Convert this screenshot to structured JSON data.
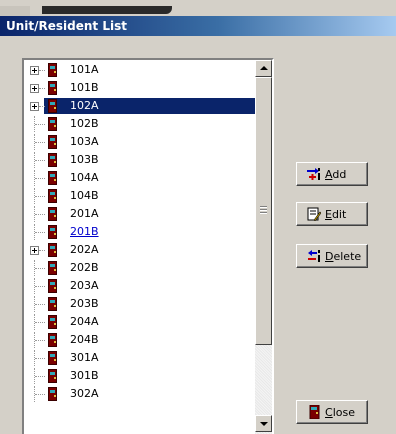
{
  "window": {
    "title": "Unit/Resident List"
  },
  "tree": {
    "items": [
      {
        "label": "101A",
        "expandable": true,
        "selected": false,
        "link": false
      },
      {
        "label": "101B",
        "expandable": true,
        "selected": false,
        "link": false
      },
      {
        "label": "102A",
        "expandable": true,
        "selected": true,
        "link": false
      },
      {
        "label": "102B",
        "expandable": false,
        "selected": false,
        "link": false
      },
      {
        "label": "103A",
        "expandable": false,
        "selected": false,
        "link": false
      },
      {
        "label": "103B",
        "expandable": false,
        "selected": false,
        "link": false
      },
      {
        "label": "104A",
        "expandable": false,
        "selected": false,
        "link": false
      },
      {
        "label": "104B",
        "expandable": false,
        "selected": false,
        "link": false
      },
      {
        "label": "201A",
        "expandable": false,
        "selected": false,
        "link": false
      },
      {
        "label": "201B",
        "expandable": false,
        "selected": false,
        "link": true
      },
      {
        "label": "202A",
        "expandable": true,
        "selected": false,
        "link": false
      },
      {
        "label": "202B",
        "expandable": false,
        "selected": false,
        "link": false
      },
      {
        "label": "203A",
        "expandable": false,
        "selected": false,
        "link": false
      },
      {
        "label": "203B",
        "expandable": false,
        "selected": false,
        "link": false
      },
      {
        "label": "204A",
        "expandable": false,
        "selected": false,
        "link": false
      },
      {
        "label": "204B",
        "expandable": false,
        "selected": false,
        "link": false
      },
      {
        "label": "301A",
        "expandable": false,
        "selected": false,
        "link": false
      },
      {
        "label": "301B",
        "expandable": false,
        "selected": false,
        "link": false
      },
      {
        "label": "302A",
        "expandable": false,
        "selected": false,
        "link": false
      }
    ]
  },
  "buttons": {
    "add": {
      "mnemonic": "A",
      "rest": "dd",
      "icon": "add-icon"
    },
    "edit": {
      "mnemonic": "E",
      "rest": "dit",
      "icon": "edit-icon"
    },
    "delete": {
      "mnemonic": "D",
      "rest": "elete",
      "icon": "delete-icon"
    },
    "close": {
      "mnemonic": "C",
      "rest": "lose",
      "icon": "door-icon"
    }
  },
  "colors": {
    "selection": "#0a246a",
    "door": "#7a0000",
    "link": "#0000cc"
  }
}
